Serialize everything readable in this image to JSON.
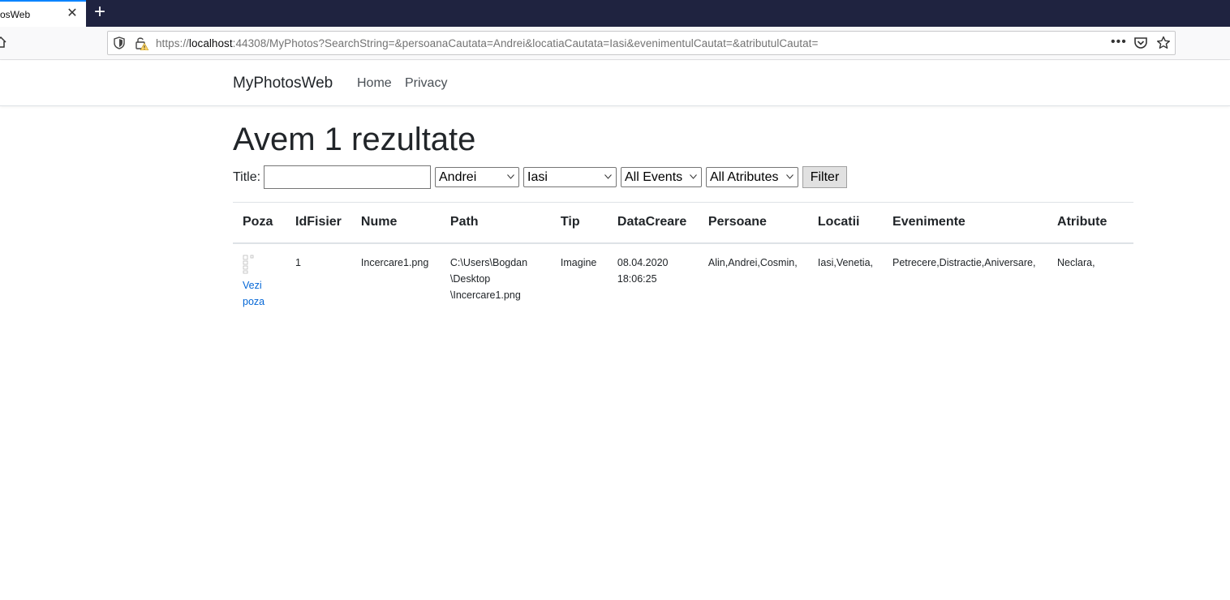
{
  "browser": {
    "tab_title": "osWeb",
    "url_prefix": "https://",
    "url_host": "localhost",
    "url_rest": ":44308/MyPhotos?SearchString=&persoanaCautata=Andrei&locatiaCautata=Iasi&evenimentulCautat=&atributulCautat="
  },
  "nav": {
    "brand": "MyPhotosWeb",
    "links": [
      "Home",
      "Privacy"
    ]
  },
  "page": {
    "title": "Avem 1 rezultate"
  },
  "filter": {
    "title_label": "Title:",
    "title_value": "",
    "person": "Andrei",
    "location": "Iasi",
    "event": "All Events",
    "attribute": "All Atributes",
    "button": "Filter"
  },
  "table": {
    "headers": [
      "Poza",
      "IdFisier",
      "Nume",
      "Path",
      "Tip",
      "DataCreare",
      "Persoane",
      "Locatii",
      "Evenimente",
      "Atribute"
    ],
    "rows": [
      {
        "link_line1": "Vezi",
        "link_line2": "poza",
        "id": "1",
        "name": "Incercare1.png",
        "path1": "C:\\Users\\Bogdan",
        "path2": "\\Desktop",
        "path3": "\\Incercare1.png",
        "type": "Imagine",
        "date": "08.04.2020",
        "time": "18:06:25",
        "persons": "Alin,Andrei,Cosmin,",
        "locations": "Iasi,Venetia,",
        "events": "Petrecere,Distractie,Aniversare,",
        "attributes": "Neclara,"
      }
    ]
  },
  "colors": {
    "tabbar": "#1f2340",
    "link": "#0366d6",
    "tab_accent": "#0a84ff"
  }
}
